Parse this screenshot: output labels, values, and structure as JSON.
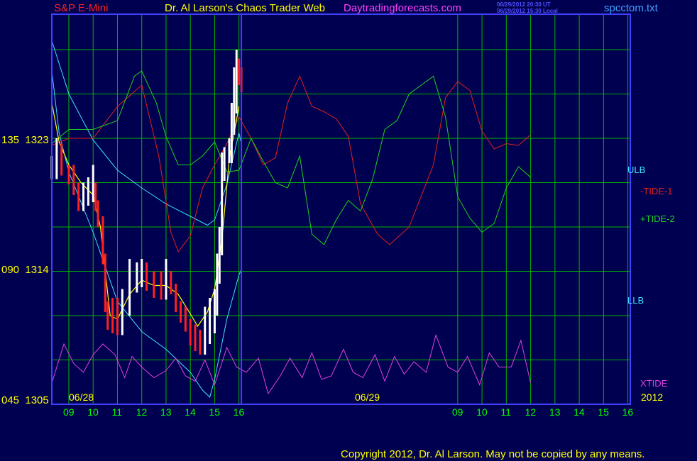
{
  "header": {
    "symbol": "S&P E-Mini",
    "title": "Dr. Al Larson's Chaos Trader Web",
    "site": "Daytradingforecasts.com",
    "ts1": "06/29/2012 20:30 UT",
    "ts2": "06/29/2012 15:30 Local",
    "file": "spcctom.txt"
  },
  "footer": {
    "copyright": "Copyright 2012, Dr. Al Larson. May not be copied by any means."
  },
  "colors": {
    "background": "#000050",
    "grid": "#00b400",
    "frame": "#4040ff",
    "price_down": "#ff2020",
    "price_up": "#ffffff",
    "moving_average": "#ffff00",
    "bands": "#40e0ff",
    "tide1": "#e02020",
    "tide2": "#20d020",
    "xtide": "#e040e0",
    "day_label": "#00ff00"
  },
  "chart_data": {
    "type": "line",
    "y_axis": {
      "range": [
        1305,
        1327
      ],
      "ticks": [
        {
          "code": "045",
          "value": 1305,
          "label": "045  1305"
        },
        {
          "code": "090",
          "value": 1314,
          "label": "090  1314"
        },
        {
          "code": "135",
          "value": 1323,
          "label": "135  1323"
        }
      ]
    },
    "x_axis": {
      "date_labels": [
        "06/28",
        "06/29",
        "2012"
      ],
      "hour_labels": [
        "09",
        "10",
        "11",
        "12",
        "13",
        "14",
        "15",
        "16",
        "09",
        "10",
        "11",
        "12",
        "13",
        "14",
        "15",
        "16"
      ],
      "range_hours": [
        8.3,
        32.1
      ],
      "now_marker_hour": 16.1
    },
    "grid": true,
    "series": [
      {
        "name": "ULB",
        "style": "band",
        "x": [
          8.3,
          9,
          10,
          11,
          12,
          13,
          14,
          14.7,
          15,
          15.5,
          16,
          16.1
        ],
        "y": [
          1325.5,
          1322.5,
          1319.9,
          1318.2,
          1317.2,
          1316.3,
          1315.6,
          1315.1,
          1315.4,
          1317.4,
          1320.3,
          1319.7
        ]
      },
      {
        "name": "LLB",
        "style": "band",
        "x": [
          8.3,
          8.6,
          9,
          10,
          11,
          12,
          13,
          14,
          14.5,
          14.8,
          15,
          15.5,
          16,
          16.1
        ],
        "y": [
          1323.8,
          1320.3,
          1318.1,
          1314.7,
          1310.8,
          1309.1,
          1308.1,
          1306.8,
          1305.8,
          1305.4,
          1306.4,
          1309.8,
          1312.3,
          1312.6
        ]
      },
      {
        "name": "-TIDE-1",
        "style": "tide",
        "x": [
          8.3,
          9,
          10,
          11,
          12,
          12.7,
          13.2,
          13.5,
          14,
          14.5,
          15,
          15.5,
          16,
          16.5,
          17,
          17.5,
          18,
          18.5,
          19,
          19.5,
          20,
          20.5,
          21,
          21.7,
          22.2,
          23,
          24,
          24.5,
          25,
          25.5,
          26,
          26.5,
          27,
          27.5,
          28
        ],
        "y": [
          1319.6,
          1320,
          1320,
          1321.8,
          1323,
          1319,
          1314.7,
          1313.6,
          1314.5,
          1317.2,
          1318.5,
          1319.7,
          1321.2,
          1320,
          1318.5,
          1318.9,
          1322,
          1323.5,
          1321.8,
          1321.5,
          1321.1,
          1320.1,
          1316.3,
          1314.6,
          1314,
          1315,
          1318.5,
          1322.3,
          1323.2,
          1322.7,
          1320.4,
          1319.4,
          1319.7,
          1319.6,
          1320.2
        ]
      },
      {
        "name": "+TIDE-2",
        "style": "tide",
        "x": [
          8.3,
          9,
          10,
          11,
          11.7,
          12,
          12.6,
          13,
          13.5,
          14,
          14.5,
          15,
          15.5,
          16,
          16.5,
          17,
          17.5,
          18,
          18.5,
          19,
          19.5,
          20,
          20.5,
          21,
          21.5,
          22,
          22.5,
          23,
          23.5,
          24,
          24.5,
          25,
          25.5,
          26,
          26.5,
          27,
          27.5,
          28
        ],
        "y": [
          1319.7,
          1320.5,
          1320.5,
          1321,
          1323.5,
          1323.8,
          1322,
          1320.1,
          1318.5,
          1318.5,
          1319,
          1319.8,
          1318.1,
          1318.2,
          1320,
          1318.7,
          1317.5,
          1317.2,
          1319,
          1314.6,
          1314,
          1315.4,
          1316.5,
          1315.9,
          1317.7,
          1320.5,
          1321,
          1322.5,
          1323,
          1323.5,
          1321.2,
          1316.7,
          1315.5,
          1314.7,
          1315.2,
          1317.2,
          1318.4,
          1317.8
        ]
      },
      {
        "name": "XTIDE",
        "style": "xtide",
        "x": [
          8.3,
          8.8,
          9.2,
          9.6,
          10,
          10.4,
          10.9,
          11.3,
          11.6,
          12,
          12.5,
          13,
          13.4,
          13.8,
          14.2,
          14.6,
          15,
          15.5,
          15.9,
          16.3,
          16.8,
          17.2,
          17.7,
          18.1,
          18.6,
          19,
          19.4,
          19.8,
          20.3,
          20.7,
          21.1,
          21.6,
          22,
          22.4,
          22.8,
          23.2,
          23.7,
          24.1,
          24.6,
          25,
          25.4,
          25.9,
          26.3,
          26.7,
          27.2,
          27.6,
          28
        ],
        "y": [
          1306.2,
          1308.4,
          1307.3,
          1306.8,
          1307.8,
          1308.4,
          1307.8,
          1306.5,
          1307.7,
          1307.1,
          1306.5,
          1306.9,
          1307.6,
          1306.6,
          1306.3,
          1307.5,
          1306.1,
          1308.2,
          1307.1,
          1306.8,
          1307.6,
          1305.6,
          1306.6,
          1307.6,
          1306.5,
          1307.9,
          1306.4,
          1306.6,
          1308.1,
          1306.8,
          1306.5,
          1307.8,
          1306.3,
          1307.7,
          1306.7,
          1307.4,
          1306.8,
          1308.9,
          1307.1,
          1306.8,
          1307.7,
          1306.1,
          1307.9,
          1307.1,
          1307.1,
          1308.6,
          1306.2
        ]
      },
      {
        "name": "Moving Average",
        "style": "ma",
        "x": [
          8.3,
          8.6,
          9,
          9.5,
          10,
          10.3,
          10.7,
          11,
          11.5,
          12,
          12.5,
          13,
          13.5,
          14,
          14.3,
          14.7,
          15,
          15.3,
          15.6,
          16
        ],
        "y": [
          1322,
          1319.8,
          1318.5,
          1317.5,
          1316.8,
          1315,
          1310,
          1309.8,
          1311.2,
          1312,
          1311.7,
          1311.7,
          1311.2,
          1310.1,
          1309.4,
          1310.2,
          1311.5,
          1314.3,
          1318.8,
          1321.8
        ]
      }
    ],
    "price": {
      "type": "candlestick",
      "x": [
        8.3,
        8.5,
        8.7,
        9,
        9.2,
        9.4,
        9.6,
        9.8,
        10,
        10.1,
        10.2,
        10.4,
        10.5,
        10.6,
        10.8,
        11,
        11.2,
        11.5,
        11.8,
        12,
        12.2,
        12.5,
        12.8,
        13,
        13.2,
        13.4,
        13.6,
        13.8,
        14,
        14.2,
        14.4,
        14.6,
        14.8,
        15,
        15.1,
        15.2,
        15.3,
        15.4,
        15.6,
        15.7,
        15.8,
        15.9,
        16,
        16.1
      ],
      "close": [
        1318.3,
        1319.7,
        1318.5,
        1318,
        1317.4,
        1316.5,
        1316.8,
        1317,
        1317.5,
        1316.5,
        1315.6,
        1313.5,
        1310.8,
        1309.8,
        1309.6,
        1309.5,
        1310.6,
        1311.9,
        1312.2,
        1312.5,
        1312,
        1311.6,
        1311.5,
        1312,
        1311.8,
        1310.8,
        1310.2,
        1309.7,
        1308.9,
        1308.6,
        1308.4,
        1309,
        1309.6,
        1310.6,
        1312.4,
        1314,
        1318.2,
        1319.2,
        1319.2,
        1320.8,
        1322,
        1324,
        1323.6,
        1323.2
      ],
      "high": [
        1319,
        1320,
        1319.3,
        1318.5,
        1318.5,
        1317.5,
        1317.5,
        1317.8,
        1318.5,
        1317.5,
        1316.5,
        1314.5,
        1311.5,
        1310.5,
        1311,
        1311,
        1311.5,
        1313.2,
        1313,
        1313.2,
        1313,
        1312.5,
        1312.5,
        1313.2,
        1312.5,
        1311.5,
        1310.8,
        1310.5,
        1309.8,
        1309.5,
        1309.2,
        1310.5,
        1311,
        1311.5,
        1313.5,
        1315,
        1319.2,
        1319.5,
        1320,
        1322,
        1324,
        1325,
        1324.5,
        1324
      ]
    }
  },
  "legend": {
    "ulb": "ULB",
    "tide1": "-TIDE-1",
    "tide2": "+TIDE-2",
    "llb": "LLB",
    "xtide": "XTIDE"
  }
}
